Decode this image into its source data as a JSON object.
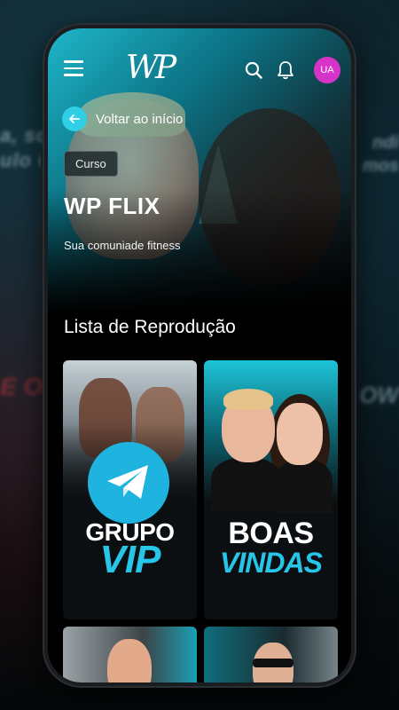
{
  "background": {
    "blur_texts": [
      "a, sol",
      "ulo Co",
      "E OF",
      "ndi",
      "mos",
      "OW"
    ]
  },
  "header": {
    "logo": "WP",
    "avatar_initials": "UA",
    "back_label": "Voltar ao início"
  },
  "hero": {
    "badge": "Curso",
    "title": "WP FLIX",
    "subtitle": "Sua comuniade fitness"
  },
  "playlist": {
    "heading": "Lista de Reprodução",
    "cards": [
      {
        "line1": "GRUPO",
        "line2": "VIP"
      },
      {
        "line1": "BOAS",
        "line2": "VINDAS"
      }
    ]
  },
  "colors": {
    "accent": "#2fd0e6",
    "avatar": "#d633c9",
    "telegram": "#1fb3e0"
  }
}
